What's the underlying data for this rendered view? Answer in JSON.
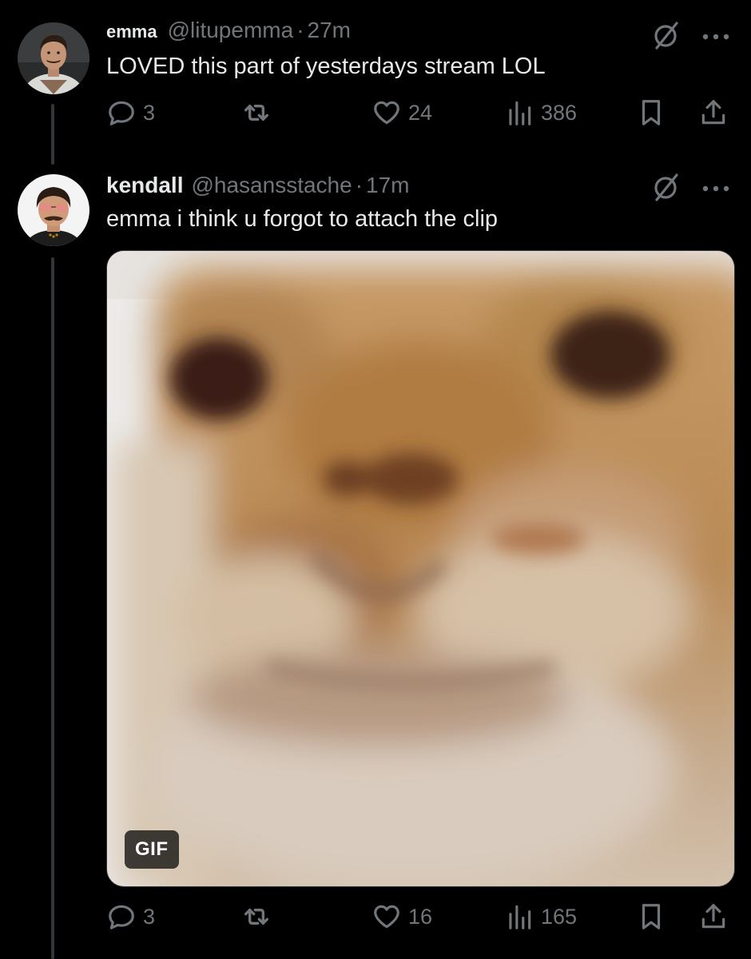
{
  "tweets": [
    {
      "name": "emma",
      "handle": "@litupemma",
      "separator": "·",
      "time": "27m",
      "text": "LOVED this part of yesterdays stream LOL",
      "replies": "3",
      "retweets": "",
      "likes": "24",
      "views": "386"
    },
    {
      "name": "kendall",
      "handle": "@hasansstache",
      "separator": "·",
      "time": "17m",
      "text": "emma i think u forgot to attach the clip",
      "media_badge": "GIF",
      "replies": "3",
      "retweets": "",
      "likes": "16",
      "views": "165"
    }
  ],
  "colors": {
    "background": "#000000",
    "primary_text": "#e7e9ea",
    "secondary_text": "#71767b",
    "thread_line": "#333639"
  },
  "icons": {
    "reply": "reply-icon",
    "retweet": "retweet-icon",
    "like": "heart-icon",
    "views": "views-icon",
    "bookmark": "bookmark-icon",
    "share": "share-icon",
    "grok": "grok-icon",
    "more": "more-icon"
  }
}
